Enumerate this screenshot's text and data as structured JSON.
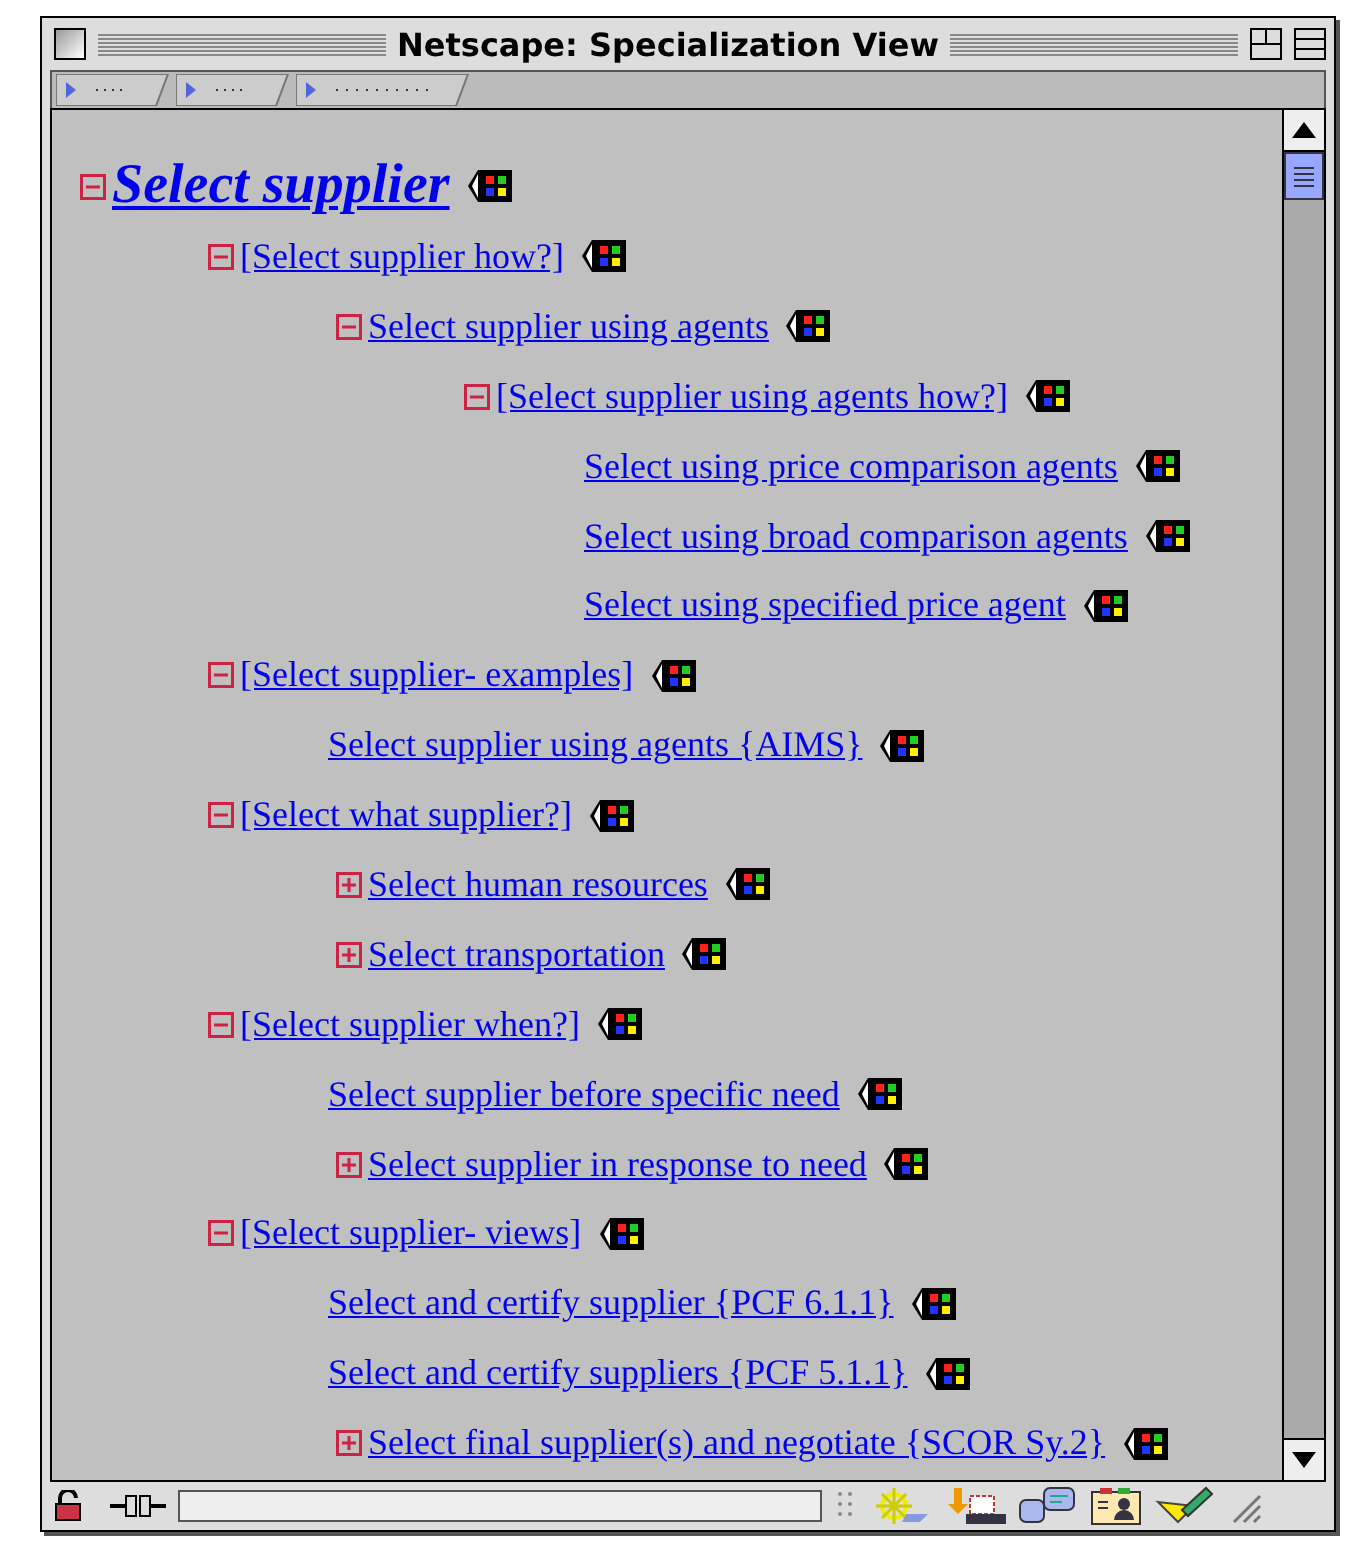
{
  "window": {
    "title": "Netscape: Specialization View"
  },
  "tree": [
    {
      "label": "Select supplier",
      "kind": "branch",
      "expanded": true,
      "children": [
        {
          "label": "[Select supplier how?]",
          "kind": "branch",
          "expanded": true,
          "children": [
            {
              "label": "Select supplier using agents",
              "kind": "branch",
              "expanded": true,
              "children": [
                {
                  "label": "[Select supplier using agents how?]",
                  "kind": "branch",
                  "expanded": true,
                  "children": [
                    {
                      "label": "Select using price comparison agents",
                      "kind": "leaf"
                    },
                    {
                      "label": "Select using broad comparison agents",
                      "kind": "leaf"
                    },
                    {
                      "label": "Select using specified price agent",
                      "kind": "leaf"
                    }
                  ]
                }
              ]
            }
          ]
        },
        {
          "label": "[Select supplier- examples]",
          "kind": "branch",
          "expanded": true,
          "children": [
            {
              "label": "Select supplier using agents {AIMS}",
              "kind": "leaf"
            }
          ]
        },
        {
          "label": "[Select what supplier?]",
          "kind": "branch",
          "expanded": true,
          "children": [
            {
              "label": "Select human resources",
              "kind": "branch",
              "expanded": false
            },
            {
              "label": "Select transportation",
              "kind": "branch",
              "expanded": false
            }
          ]
        },
        {
          "label": "[Select supplier when?]",
          "kind": "branch",
          "expanded": true,
          "children": [
            {
              "label": "Select supplier before specific need",
              "kind": "leaf"
            },
            {
              "label": "Select supplier in response to need",
              "kind": "branch",
              "expanded": false
            }
          ]
        },
        {
          "label": "[Select supplier- views]",
          "kind": "branch",
          "expanded": true,
          "children": [
            {
              "label": "Select and certify supplier {PCF 6.1.1}",
              "kind": "leaf"
            },
            {
              "label": "Select and certify suppliers {PCF 5.1.1}",
              "kind": "leaf"
            },
            {
              "label": "Select final supplier(s) and negotiate {SCOR Sy.2}",
              "kind": "branch",
              "expanded": false
            }
          ]
        }
      ]
    }
  ]
}
